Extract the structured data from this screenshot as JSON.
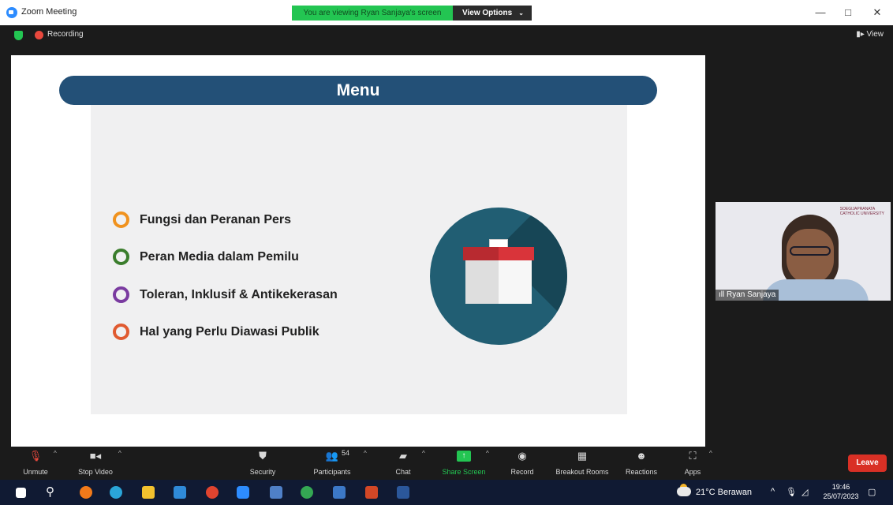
{
  "window": {
    "title": "Zoom Meeting",
    "viewing_banner": "You are viewing Ryan Sanjaya's screen",
    "view_options_label": "View Options",
    "minimize": "—",
    "maximize": "□",
    "close": "✕"
  },
  "meeting_bar": {
    "recording_label": "Recording",
    "view_label": "View"
  },
  "slide": {
    "title": "Menu",
    "items": [
      {
        "label": "Fungsi dan Peranan Pers",
        "color": "#f0921e"
      },
      {
        "label": "Peran Media dalam Pemilu",
        "color": "#3a7d2c"
      },
      {
        "label": "Toleran, Inklusif & Antikekerasan",
        "color": "#7a3ba0"
      },
      {
        "label": "Hal yang Perlu Diawasi Publik",
        "color": "#e05a30"
      }
    ],
    "illustration": "ballot-box-icon"
  },
  "participant_tile": {
    "name": "Ryan Sanjaya",
    "logo_text": "SOEGIJAPRANATA\nCATHOLIC UNIVERSITY"
  },
  "toolbar": {
    "unmute": "Unmute",
    "stop_video": "Stop Video",
    "security": "Security",
    "participants": "Participants",
    "participant_count": "54",
    "chat": "Chat",
    "share_screen": "Share Screen",
    "record": "Record",
    "breakout_rooms": "Breakout Rooms",
    "reactions": "Reactions",
    "apps": "Apps",
    "leave": "Leave"
  },
  "taskbar": {
    "weather": "21°C  Berawan",
    "time": "19:46",
    "date": "25/07/2023"
  }
}
